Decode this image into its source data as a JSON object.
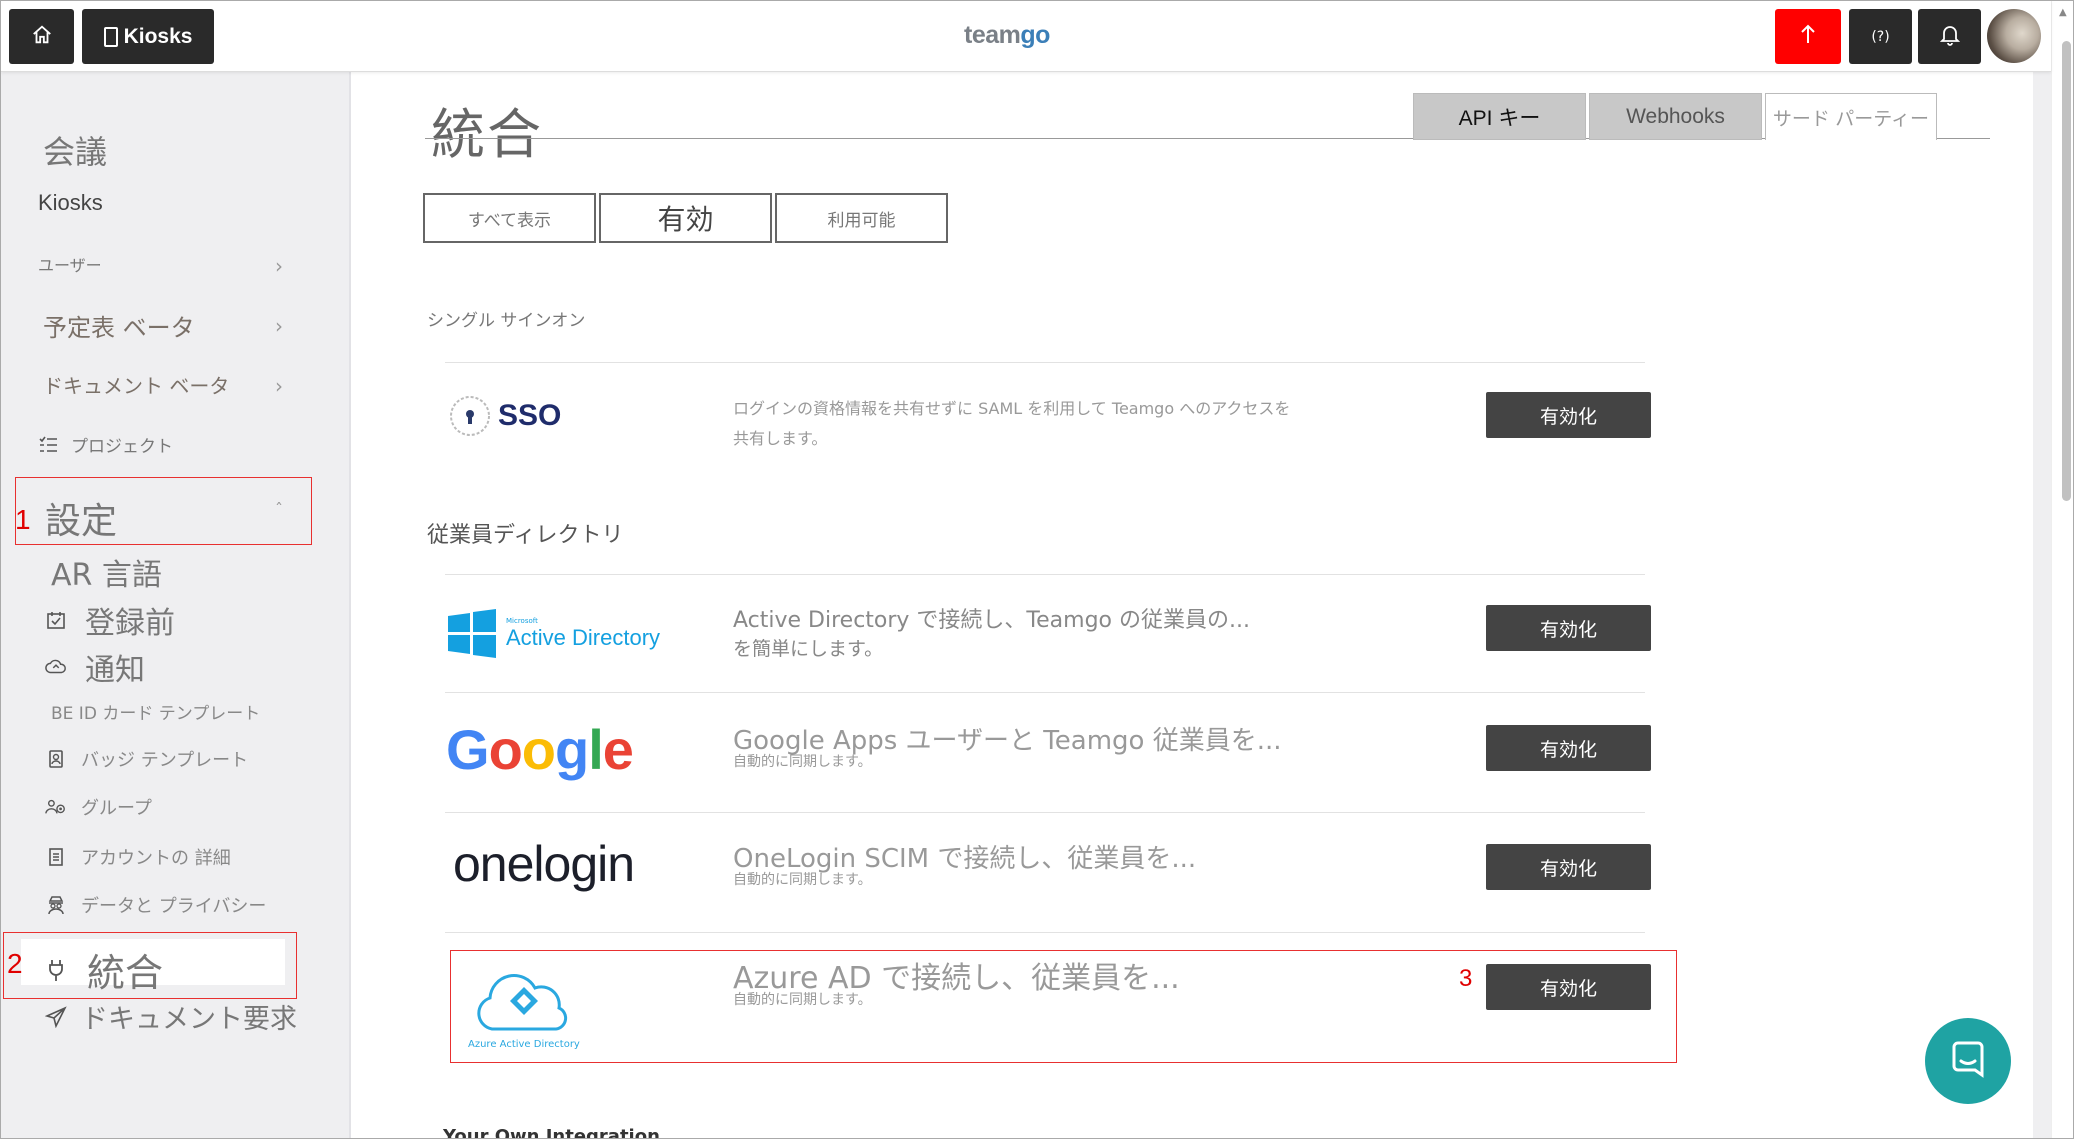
{
  "topbar": {
    "kiosks_label": "Kiosks",
    "logo_text": "teamgo",
    "help_label": "(?)"
  },
  "sidebar": {
    "items": [
      {
        "label": "会議"
      },
      {
        "label": "Kiosks"
      },
      {
        "label": "ユーザー"
      },
      {
        "label": "予定表 ベータ"
      },
      {
        "label": "ドキュメント ベータ"
      },
      {
        "label": "プロジェクト"
      },
      {
        "label": "設定"
      },
      {
        "label": "AR 言語"
      },
      {
        "label": "登録前"
      },
      {
        "label": "通知"
      },
      {
        "label": "BE ID カード テンプレート"
      },
      {
        "label": "バッジ テンプレート"
      },
      {
        "label": "グループ"
      },
      {
        "label": "アカウントの 詳細"
      },
      {
        "label": "データと プライバシー"
      },
      {
        "label": "統合"
      },
      {
        "label": "ドキュメント要求"
      }
    ]
  },
  "annotations": {
    "label1": "1",
    "label2": "2",
    "label3": "3"
  },
  "main": {
    "title": "統合",
    "tabs": [
      "API キー",
      "Webhooks",
      "サード パーティー"
    ],
    "filters": [
      "すべて表示",
      "有効",
      "利用可能"
    ],
    "sections": {
      "sso": "シングル サインオン",
      "directory": "従業員ディレクトリ",
      "own": "Your Own Integration"
    },
    "rows": [
      {
        "logo": "SSO",
        "line1": "ログインの資格情報を共有せずに SAML を利用して Teamgo へのアクセスを",
        "line2": "共有します。",
        "button": "有効化"
      },
      {
        "logo": "Active Directory",
        "logo_small": "Microsoft",
        "line1": "Active  Directory で接続し、Teamgo の従業員の...",
        "line2": "を簡単にします。",
        "button": "有効化"
      },
      {
        "logo": "Google",
        "line1": "Google Apps ユーザーと Teamgo 従業員を...",
        "line2": "自動的に同期します。",
        "button": "有効化"
      },
      {
        "logo": "onelogin",
        "line1": "OneLogin  SCIM で接続し、従業員を...",
        "line2": "自動的に同期します。",
        "button": "有効化"
      },
      {
        "logo": "Azure Active Directory",
        "line1": "Azure  AD で接続し、従業員を...",
        "line2": "自動的に同期します。",
        "button": "有効化"
      }
    ]
  },
  "colors": {
    "accent_red": "#ff0000",
    "button_dark": "#444444",
    "chat": "#1fa3a3",
    "highlight": "#e83030"
  }
}
